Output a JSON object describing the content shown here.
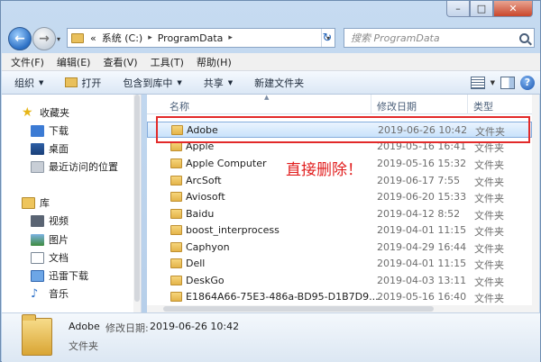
{
  "window": {
    "controls": {
      "minimize": "–",
      "maximize": "□",
      "close": "✕"
    }
  },
  "address": {
    "back_glyph": "←",
    "forward_glyph": "→",
    "prefix": "«",
    "crumbs": [
      "系统 (C:)",
      "ProgramData"
    ],
    "separator": "▸",
    "refresh_glyph": "↻",
    "dropdown_glyph": "▾"
  },
  "search": {
    "placeholder": "搜索 ProgramData"
  },
  "menu": [
    "文件(F)",
    "编辑(E)",
    "查看(V)",
    "工具(T)",
    "帮助(H)"
  ],
  "toolbar": {
    "organize": "组织",
    "open": "打开",
    "include_library": "包含到库中",
    "share": "共享",
    "new_folder": "新建文件夹",
    "help": "?"
  },
  "nav": {
    "favorites": "收藏夹",
    "downloads": "下载",
    "desktop": "桌面",
    "recent": "最近访问的位置",
    "libraries": "库",
    "videos": "视频",
    "pictures": "图片",
    "documents": "文档",
    "thunder": "迅雷下载",
    "music": "音乐"
  },
  "columns": {
    "name": "名称",
    "date": "修改日期",
    "type": "类型"
  },
  "files": [
    {
      "name": "Adobe",
      "date": "2019-06-26 10:42",
      "type": "文件夹",
      "selected": true
    },
    {
      "name": "Apple",
      "date": "2019-05-16 16:41",
      "type": "文件夹"
    },
    {
      "name": "Apple Computer",
      "date": "2019-05-16 15:32",
      "type": "文件夹"
    },
    {
      "name": "ArcSoft",
      "date": "2019-06-17 7:55",
      "type": "文件夹"
    },
    {
      "name": "Aviosoft",
      "date": "2019-06-20 15:33",
      "type": "文件夹"
    },
    {
      "name": "Baidu",
      "date": "2019-04-12 8:52",
      "type": "文件夹"
    },
    {
      "name": "boost_interprocess",
      "date": "2019-04-01 11:15",
      "type": "文件夹"
    },
    {
      "name": "Caphyon",
      "date": "2019-04-29 16:44",
      "type": "文件夹"
    },
    {
      "name": "Dell",
      "date": "2019-04-01 11:15",
      "type": "文件夹"
    },
    {
      "name": "DeskGo",
      "date": "2019-04-03 13:11",
      "type": "文件夹"
    },
    {
      "name": "E1864A66-75E3-486a-BD95-D1B7D9...",
      "date": "2019-05-16 16:40",
      "type": "文件夹"
    }
  ],
  "annotation": "直接删除！",
  "details": {
    "name": "Adobe",
    "date_label": "修改日期:",
    "date": "2019-06-26 10:42",
    "type": "文件夹"
  }
}
